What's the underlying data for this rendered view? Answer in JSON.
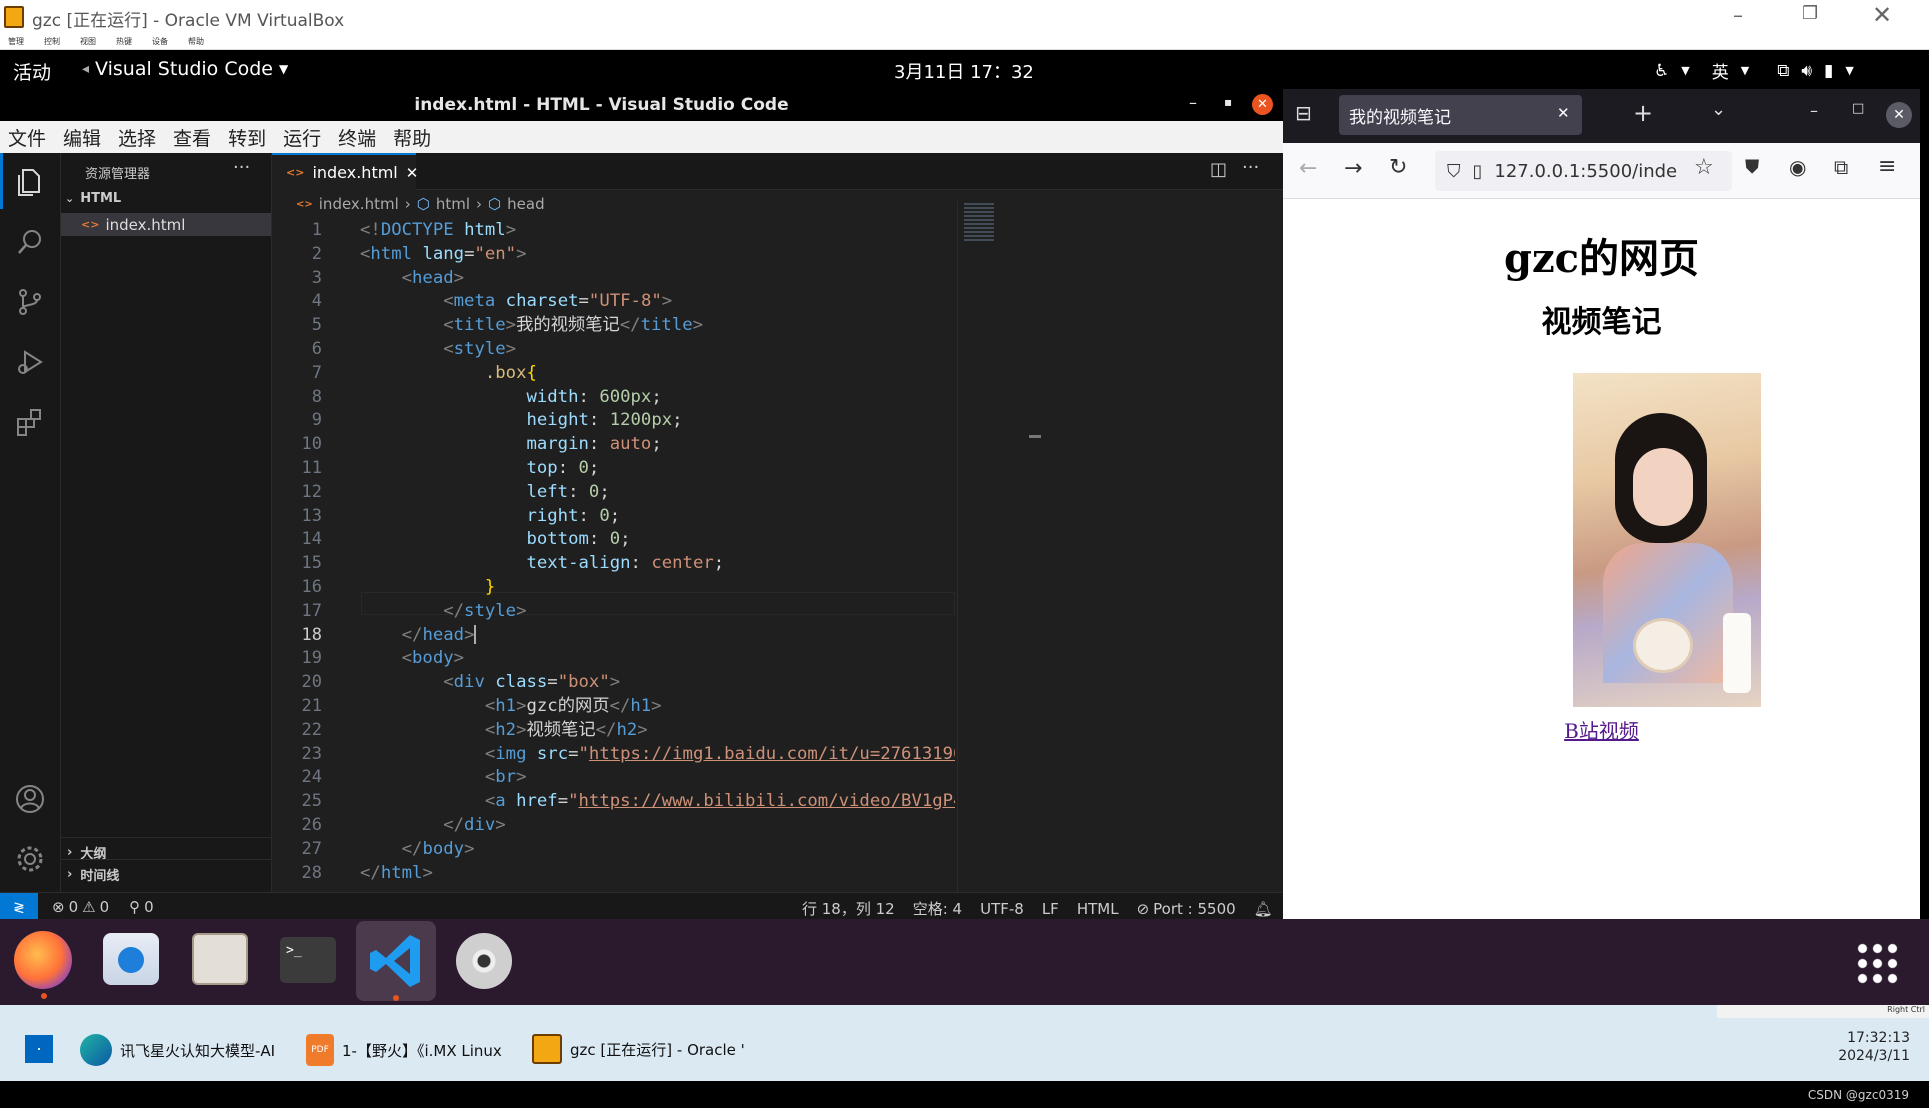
{
  "vbox": {
    "title": "gzc [正在运行] - Oracle VM VirtualBox",
    "menus": [
      "管理",
      "控制",
      "视图",
      "热键",
      "设备",
      "帮助"
    ]
  },
  "topbar": {
    "activities": "活动",
    "app": "Visual Studio Code",
    "datetime": "3月11日  17：32",
    "lang": "英"
  },
  "vscode": {
    "title": "index.html - HTML - Visual Studio Code",
    "menu": [
      "文件",
      "编辑",
      "选择",
      "查看",
      "转到",
      "运行",
      "终端",
      "帮助"
    ],
    "explorer_title": "资源管理器",
    "folder": "HTML",
    "file": "index.html",
    "outline": "大纲",
    "timeline": "时间线",
    "tab": "index.html",
    "breadcrumb": [
      "index.html",
      "html",
      "head"
    ],
    "status": {
      "errors": "0",
      "warnings": "0",
      "ports": "0",
      "position": "行 18，列 12",
      "spaces": "空格: 4",
      "encoding": "UTF-8",
      "eol": "LF",
      "lang": "HTML",
      "port": "Port : 5500"
    },
    "lines": [
      [
        [
          "tg",
          "<!"
        ],
        [
          "tn",
          "DOCTYPE"
        ],
        [
          "tx",
          " "
        ],
        [
          "at",
          "html"
        ],
        [
          "tg",
          ">"
        ]
      ],
      [
        [
          "tg",
          "<"
        ],
        [
          "tn",
          "html"
        ],
        [
          "tx",
          " "
        ],
        [
          "at",
          "lang"
        ],
        [
          "tx",
          "="
        ],
        [
          "st",
          "\"en\""
        ],
        [
          "tg",
          ">"
        ]
      ],
      [
        [
          "tx",
          "    "
        ],
        [
          "tg",
          "<"
        ],
        [
          "tn",
          "head"
        ],
        [
          "tg",
          ">"
        ]
      ],
      [
        [
          "tx",
          "        "
        ],
        [
          "tg",
          "<"
        ],
        [
          "tn",
          "meta"
        ],
        [
          "tx",
          " "
        ],
        [
          "at",
          "charset"
        ],
        [
          "tx",
          "="
        ],
        [
          "st",
          "\"UTF-8\""
        ],
        [
          "tg",
          ">"
        ]
      ],
      [
        [
          "tx",
          "        "
        ],
        [
          "tg",
          "<"
        ],
        [
          "tn",
          "title"
        ],
        [
          "tg",
          ">"
        ],
        [
          "tx",
          "我的视频笔记"
        ],
        [
          "tg",
          "</"
        ],
        [
          "tn",
          "title"
        ],
        [
          "tg",
          ">"
        ]
      ],
      [
        [
          "tx",
          "        "
        ],
        [
          "tg",
          "<"
        ],
        [
          "tn",
          "style"
        ],
        [
          "tg",
          ">"
        ]
      ],
      [
        [
          "tx",
          "            "
        ],
        [
          "sel",
          ".box"
        ],
        [
          "br",
          "{"
        ]
      ],
      [
        [
          "tx",
          "                "
        ],
        [
          "at",
          "width"
        ],
        [
          "tx",
          ": "
        ],
        [
          "nm",
          "600px"
        ],
        [
          "tx",
          ";"
        ]
      ],
      [
        [
          "tx",
          "                "
        ],
        [
          "at",
          "height"
        ],
        [
          "tx",
          ": "
        ],
        [
          "nm",
          "1200px"
        ],
        [
          "tx",
          ";"
        ]
      ],
      [
        [
          "tx",
          "                "
        ],
        [
          "at",
          "margin"
        ],
        [
          "tx",
          ": "
        ],
        [
          "st",
          "auto"
        ],
        [
          "tx",
          ";"
        ]
      ],
      [
        [
          "tx",
          "                "
        ],
        [
          "at",
          "top"
        ],
        [
          "tx",
          ": "
        ],
        [
          "nm",
          "0"
        ],
        [
          "tx",
          ";"
        ]
      ],
      [
        [
          "tx",
          "                "
        ],
        [
          "at",
          "left"
        ],
        [
          "tx",
          ": "
        ],
        [
          "nm",
          "0"
        ],
        [
          "tx",
          ";"
        ]
      ],
      [
        [
          "tx",
          "                "
        ],
        [
          "at",
          "right"
        ],
        [
          "tx",
          ": "
        ],
        [
          "nm",
          "0"
        ],
        [
          "tx",
          ";"
        ]
      ],
      [
        [
          "tx",
          "                "
        ],
        [
          "at",
          "bottom"
        ],
        [
          "tx",
          ": "
        ],
        [
          "nm",
          "0"
        ],
        [
          "tx",
          ";"
        ]
      ],
      [
        [
          "tx",
          "                "
        ],
        [
          "at",
          "text-align"
        ],
        [
          "tx",
          ": "
        ],
        [
          "st",
          "center"
        ],
        [
          "tx",
          ";"
        ]
      ],
      [
        [
          "tx",
          "            "
        ],
        [
          "br",
          "}"
        ]
      ],
      [
        [
          "tx",
          "        "
        ],
        [
          "tg",
          "</"
        ],
        [
          "tn",
          "style"
        ],
        [
          "tg",
          ">"
        ]
      ],
      [
        [
          "tx",
          "    "
        ],
        [
          "tg",
          "</"
        ],
        [
          "tn",
          "head"
        ],
        [
          "tg",
          ">"
        ]
      ],
      [
        [
          "tx",
          "    "
        ],
        [
          "tg",
          "<"
        ],
        [
          "tn",
          "body"
        ],
        [
          "tg",
          ">"
        ]
      ],
      [
        [
          "tx",
          "        "
        ],
        [
          "tg",
          "<"
        ],
        [
          "tn",
          "div"
        ],
        [
          "tx",
          " "
        ],
        [
          "at",
          "class"
        ],
        [
          "tx",
          "="
        ],
        [
          "st",
          "\"box\""
        ],
        [
          "tg",
          ">"
        ]
      ],
      [
        [
          "tx",
          "            "
        ],
        [
          "tg",
          "<"
        ],
        [
          "tn",
          "h1"
        ],
        [
          "tg",
          ">"
        ],
        [
          "tx",
          "gzc的网页"
        ],
        [
          "tg",
          "</"
        ],
        [
          "tn",
          "h1"
        ],
        [
          "tg",
          ">"
        ]
      ],
      [
        [
          "tx",
          "            "
        ],
        [
          "tg",
          "<"
        ],
        [
          "tn",
          "h2"
        ],
        [
          "tg",
          ">"
        ],
        [
          "tx",
          "视频笔记"
        ],
        [
          "tg",
          "</"
        ],
        [
          "tn",
          "h2"
        ],
        [
          "tg",
          ">"
        ]
      ],
      [
        [
          "tx",
          "            "
        ],
        [
          "tg",
          "<"
        ],
        [
          "tn",
          "img"
        ],
        [
          "tx",
          " "
        ],
        [
          "at",
          "src"
        ],
        [
          "tx",
          "="
        ],
        [
          "st",
          "\""
        ],
        [
          "lk",
          "https://img1.baidu.com/it/u=2761319049,4116036198&fm=253"
        ]
      ],
      [
        [
          "tx",
          "            "
        ],
        [
          "tg",
          "<"
        ],
        [
          "tn",
          "br"
        ],
        [
          "tg",
          ">"
        ]
      ],
      [
        [
          "tx",
          "            "
        ],
        [
          "tg",
          "<"
        ],
        [
          "tn",
          "a"
        ],
        [
          "tx",
          " "
        ],
        [
          "at",
          "href"
        ],
        [
          "tx",
          "="
        ],
        [
          "st",
          "\""
        ],
        [
          "lk",
          "https://www.bilibili.com/video/BV1gP4y1E75S/?spm_id_from="
        ]
      ],
      [
        [
          "tx",
          "        "
        ],
        [
          "tg",
          "</"
        ],
        [
          "tn",
          "div"
        ],
        [
          "tg",
          ">"
        ]
      ],
      [
        [
          "tx",
          "    "
        ],
        [
          "tg",
          "</"
        ],
        [
          "tn",
          "body"
        ],
        [
          "tg",
          ">"
        ]
      ],
      [
        [
          "tg",
          "</"
        ],
        [
          "tn",
          "html"
        ],
        [
          "tg",
          ">"
        ]
      ]
    ]
  },
  "firefox": {
    "tab": "我的视频笔记",
    "url": "127.0.0.1:5500/inde",
    "h1": "gzc的网页",
    "h2": "视频笔记",
    "link": "B站视频"
  },
  "taskbar": {
    "items": [
      "讯飞星火认知大模型-AI",
      "1-【野火】《i.MX Linux",
      "gzc [正在运行] - Oracle '"
    ],
    "time": "17:32:13",
    "date": "2024/3/11",
    "tray": "Right Ctrl"
  },
  "footer": "CSDN @gzc0319",
  "colors": {
    "accent": "#0078d4",
    "dock": "#2b1a2e"
  }
}
